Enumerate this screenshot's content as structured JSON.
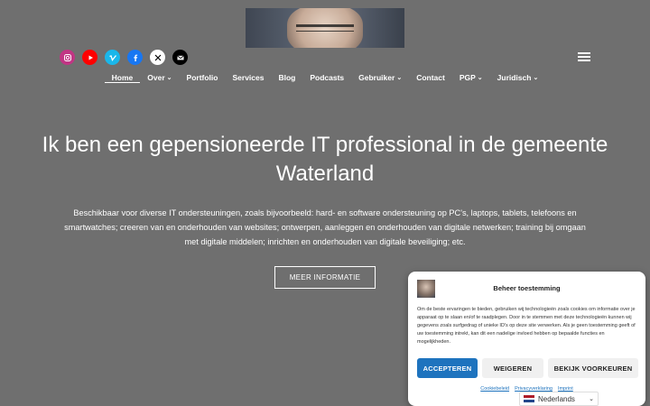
{
  "social": [
    {
      "name": "instagram-icon",
      "color": "#c13584"
    },
    {
      "name": "youtube-icon",
      "color": "#ff0000"
    },
    {
      "name": "vimeo-icon",
      "color": "#1ab7ea"
    },
    {
      "name": "facebook-icon",
      "color": "#1877f2"
    },
    {
      "name": "x-icon",
      "color": "#000000"
    },
    {
      "name": "mail-icon",
      "color": "#000000"
    }
  ],
  "nav": {
    "items": [
      {
        "label": "Home",
        "dropdown": false,
        "active": true
      },
      {
        "label": "Over",
        "dropdown": true
      },
      {
        "label": "Portfolio",
        "dropdown": false
      },
      {
        "label": "Services",
        "dropdown": false
      },
      {
        "label": "Blog",
        "dropdown": false
      },
      {
        "label": "Podcasts",
        "dropdown": false
      },
      {
        "label": "Gebruiker",
        "dropdown": true
      },
      {
        "label": "Contact",
        "dropdown": false
      },
      {
        "label": "PGP",
        "dropdown": true
      },
      {
        "label": "Juridisch",
        "dropdown": true
      }
    ]
  },
  "hero": {
    "title": "Ik ben een gepensioneerde IT professional in de gemeente Waterland",
    "lead": "Beschikbaar voor diverse IT ondersteuningen, zoals bijvoorbeeld: hard- en software ondersteuning op PC's, laptops, tablets, telefoons en smartwatches; creeren van en onderhouden van websites; ontwerpen, aanleggen en onderhouden van digitale netwerken; training bij omgaan met digitale middelen; inrichten en onderhouden van digitale beveiliging; etc.",
    "button": "MEER INFORMATIE"
  },
  "consent": {
    "title": "Beheer toestemming",
    "text": "Om de beste ervaringen te bieden, gebruiken wij technologieën zoals cookies om informatie over je apparaat op te slaan en/of te raadplegen. Door in te stemmen met deze technologieën kunnen wij gegevens zoals surfgedrag of unieke ID's op deze site verwerken. Als je geen toestemming geeft of uw toestemming intrekt, kan dit een nadelige invloed hebben op bepaalde functies en mogelijkheden.",
    "accept": "ACCEPTEREN",
    "deny": "WEIGEREN",
    "prefs": "BEKIJK VOORKEUREN",
    "links": [
      "Cookiebeleid",
      "Privacyverklaring",
      "Imprint"
    ]
  },
  "language": {
    "selected": "Nederlands"
  },
  "colors": {
    "accent": "#1e73be",
    "background": "#6f6f6f"
  }
}
